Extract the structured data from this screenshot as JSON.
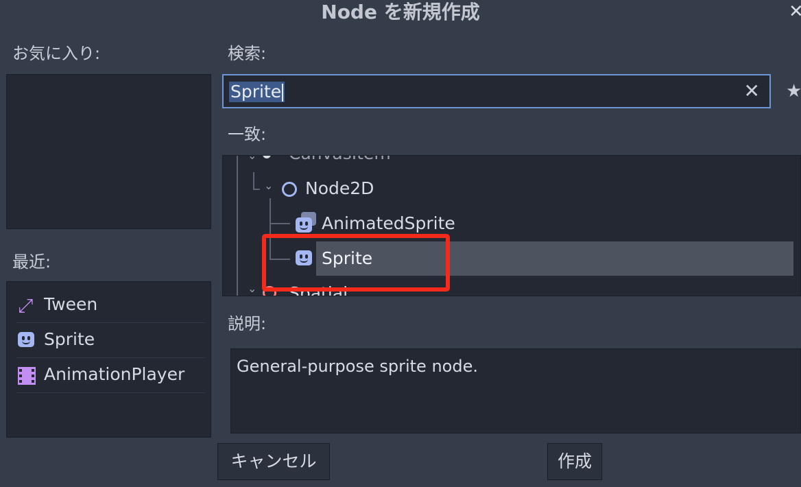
{
  "window": {
    "title": "Node を新規作成",
    "close_icon": "close-icon"
  },
  "favorites": {
    "label": "お気に入り:"
  },
  "recent": {
    "label": "最近:",
    "items": [
      {
        "label": "Tween",
        "icon": "tween-icon"
      },
      {
        "label": "Sprite",
        "icon": "sprite-icon"
      },
      {
        "label": "AnimationPlayer",
        "icon": "film-icon"
      }
    ]
  },
  "search": {
    "label": "検索:",
    "value": "Sprite",
    "clear_icon": "clear-icon",
    "favorite_icon": "star-icon"
  },
  "matches": {
    "label": "一致:",
    "tree": [
      {
        "label": "CanvasItem",
        "icon": "canvasitem-icon"
      },
      {
        "label": "Node2D",
        "icon": "node2d-icon"
      },
      {
        "label": "AnimatedSprite",
        "icon": "animatedsprite-icon"
      },
      {
        "label": "Sprite",
        "icon": "sprite-icon",
        "selected": true
      },
      {
        "label": "Spatial",
        "icon": "spatial-icon"
      }
    ]
  },
  "description": {
    "label": "説明:",
    "text": "General-purpose sprite node."
  },
  "buttons": {
    "cancel": "キャンセル",
    "create": "作成"
  },
  "colors": {
    "selection_outline": "#f42a1a",
    "accent": "#6d97d4",
    "sprite_icon": "#a5b7f3",
    "purple_icon": "#c38ef1"
  }
}
